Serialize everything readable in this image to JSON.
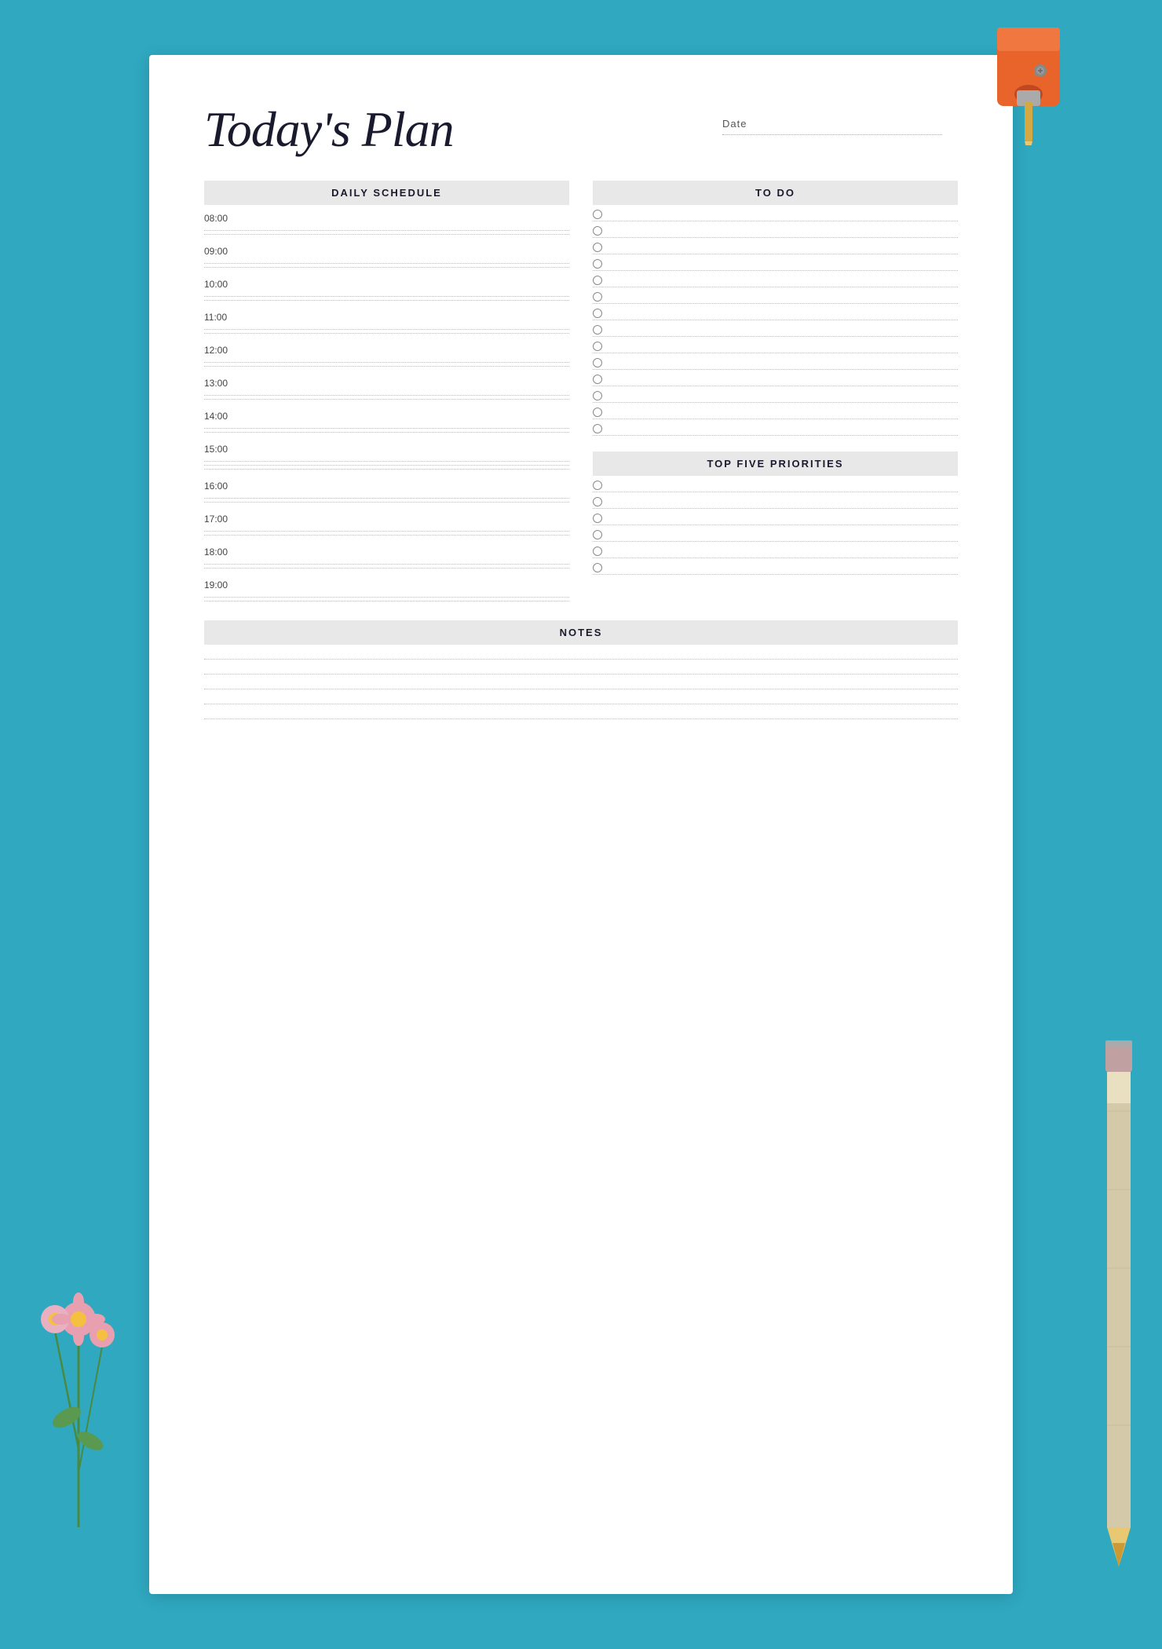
{
  "page": {
    "title": "Today's Plan",
    "date_label": "Date",
    "background_color": "#2fa8c0"
  },
  "daily_schedule": {
    "header": "DAILY SCHEDULE",
    "times": [
      "08:00",
      "09:00",
      "10:00",
      "11:00",
      "12:00",
      "13:00",
      "14:00",
      "15:00",
      "16:00",
      "17:00",
      "18:00",
      "19:00"
    ]
  },
  "todo": {
    "header": "TO DO",
    "items": 14
  },
  "priorities": {
    "header": "TOP FIVE PRIORITIES",
    "items": 6
  },
  "notes": {
    "header": "NOTES",
    "lines": 5
  }
}
